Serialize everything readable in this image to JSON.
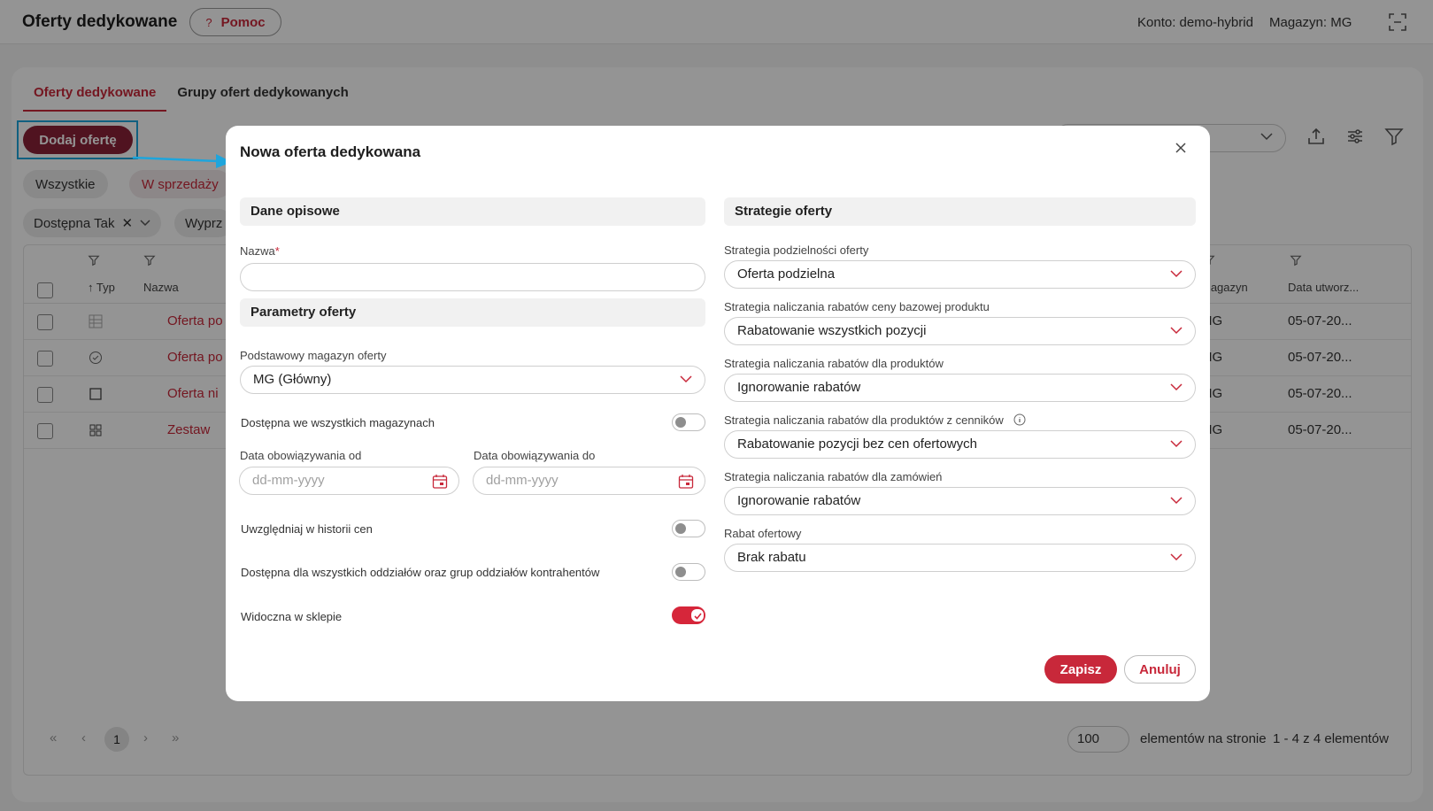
{
  "app": {
    "title": "Oferty dedykowane",
    "help_label": "Pomoc",
    "account": "Konto: demo-hybrid",
    "store": "Magazyn: MG"
  },
  "tabs": [
    "Oferty dedykowane",
    "Grupy ofert dedykowanych"
  ],
  "toolbar": {
    "add_label": "Dodaj ofertę"
  },
  "filters": {
    "all": "Wszystkie",
    "on_sale": "W sprzedaży",
    "available": "Dostępna Tak",
    "clearance": "Wyprz"
  },
  "grid": {
    "headers": {
      "type": "↑ Typ",
      "name": "Nazwa",
      "store": "Magazyn",
      "created": "Data utworz..."
    },
    "rows": [
      {
        "name": "Oferta po",
        "store": "MG",
        "created": "05-07-20..."
      },
      {
        "name": "Oferta po",
        "store": "MG",
        "created": "05-07-20..."
      },
      {
        "name": "Oferta ni",
        "store": "MG",
        "created": "05-07-20..."
      },
      {
        "name": "Zestaw",
        "store": "MG",
        "created": "05-07-20..."
      }
    ]
  },
  "pager": {
    "page": "1",
    "page_size": "100",
    "page_size_label": "elementów na stronie",
    "count": "1 - 4 z 4 elementów"
  },
  "modal": {
    "title": "Nowa oferta dedykowana",
    "left": {
      "section_desc": "Dane opisowe",
      "name_label": "Nazwa",
      "name_required": "*",
      "name_value": "",
      "section_params": "Parametry oferty",
      "base_store_label": "Podstawowy magazyn oferty",
      "base_store_value": "MG (Główny)",
      "all_stores_label": "Dostępna we wszystkich magazynach",
      "date_from_label": "Data obowiązywania od",
      "date_from_placeholder": "dd-mm-yyyy",
      "date_to_label": "Data obowiązywania do",
      "date_to_placeholder": "dd-mm-yyyy",
      "price_history_label": "Uwzględniaj w historii cen",
      "all_branches_label": "Dostępna dla wszystkich oddziałów oraz grup oddziałów kontrahentów",
      "visible_shop_label": "Widoczna w sklepie"
    },
    "toggles": {
      "all_stores": false,
      "price_history": false,
      "all_branches": false,
      "visible_shop": true
    },
    "right": {
      "section_strategies": "Strategie oferty",
      "divisibility_label": "Strategia podzielności oferty",
      "divisibility_value": "Oferta podzielna",
      "base_price_label": "Strategia naliczania rabatów ceny bazowej produktu",
      "base_price_value": "Rabatowanie wszystkich pozycji",
      "products_label": "Strategia naliczania rabatów dla produktów",
      "products_value": "Ignorowanie rabatów",
      "pricelist_label": "Strategia naliczania rabatów dla produktów z cenników",
      "pricelist_value": "Rabatowanie pozycji bez cen ofertowych",
      "orders_label": "Strategia naliczania rabatów dla zamówień",
      "orders_value": "Ignorowanie rabatów",
      "discount_label": "Rabat ofertowy",
      "discount_value": "Brak rabatu"
    },
    "save_label": "Zapisz",
    "cancel_label": "Anuluj"
  },
  "colors": {
    "accent": "#c8283a",
    "add_button": "#8a2238",
    "highlight": "#1ea5dc"
  }
}
